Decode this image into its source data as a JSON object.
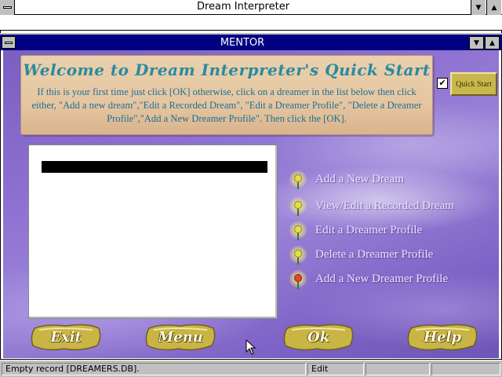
{
  "app": {
    "title": "Dream Interpreter"
  },
  "child_window": {
    "title": "MENTOR"
  },
  "welcome": {
    "heading": "Welcome to Dream Interpreter's Quick Start",
    "body": "If this is your first time just click [OK] otherwise, click on a dreamer in the list below then click either, \"Add a new dream\",\"Edit a Recorded Dream\", \"Edit a Dreamer Profile\", \"Delete a Dreamer Profile\",\"Add a New Dreamer Profile\".  Then click the [OK]."
  },
  "quick_start": {
    "label": "Quick Start",
    "checked": true,
    "check_glyph": "✔"
  },
  "options": [
    {
      "label": "Add a New Dream",
      "icon": "lightbulb-icon"
    },
    {
      "label": "View/Edit a Recorded Dream",
      "icon": "lightbulb-icon"
    },
    {
      "label": "Edit a Dreamer Profile",
      "icon": "lightbulb-icon"
    },
    {
      "label": "Delete a Dreamer Profile",
      "icon": "lightbulb-icon"
    },
    {
      "label": "Add a New Dreamer Profile",
      "icon": "lightbulb-icon-selected"
    }
  ],
  "buttons": {
    "exit": "Exit",
    "menu": "Menu",
    "ok": "Ok",
    "help": "Help"
  },
  "status": {
    "message": "Empty record [DREAMERS.DB].",
    "mode": "Edit"
  },
  "colors": {
    "canvas": "#8c6fd0",
    "heading": "#2a8aa0",
    "body_text": "#1c6f95",
    "gold": "#c8b84c",
    "titlebar": "#000080"
  }
}
